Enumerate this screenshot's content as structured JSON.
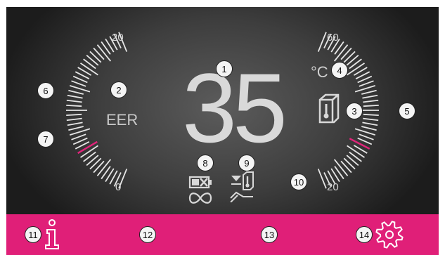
{
  "display": {
    "value": "35",
    "mode_label": "EER",
    "unit": "°C",
    "left_scale": {
      "max_label": "20",
      "min_label": "0",
      "marker_color": "#e0247a"
    },
    "right_scale": {
      "max_label": "60",
      "min_label": "20",
      "marker_color": "#e0247a"
    },
    "icons": {
      "thermometer_box": "thermometer-box-icon",
      "battery_infinity": "battery-infinity-icon",
      "lowering_thermometer": "lowering-thermometer-icon"
    }
  },
  "callouts": {
    "c1": "1",
    "c2": "2",
    "c3": "3",
    "c4": "4",
    "c5": "5",
    "c6": "6",
    "c7": "7",
    "c8": "8",
    "c9": "9",
    "c10": "10",
    "c11": "11",
    "c12": "12",
    "c13": "13",
    "c14": "14"
  },
  "footer": {
    "color": "#e01f78",
    "info_icon": "info-icon",
    "settings_icon": "gear-icon"
  }
}
